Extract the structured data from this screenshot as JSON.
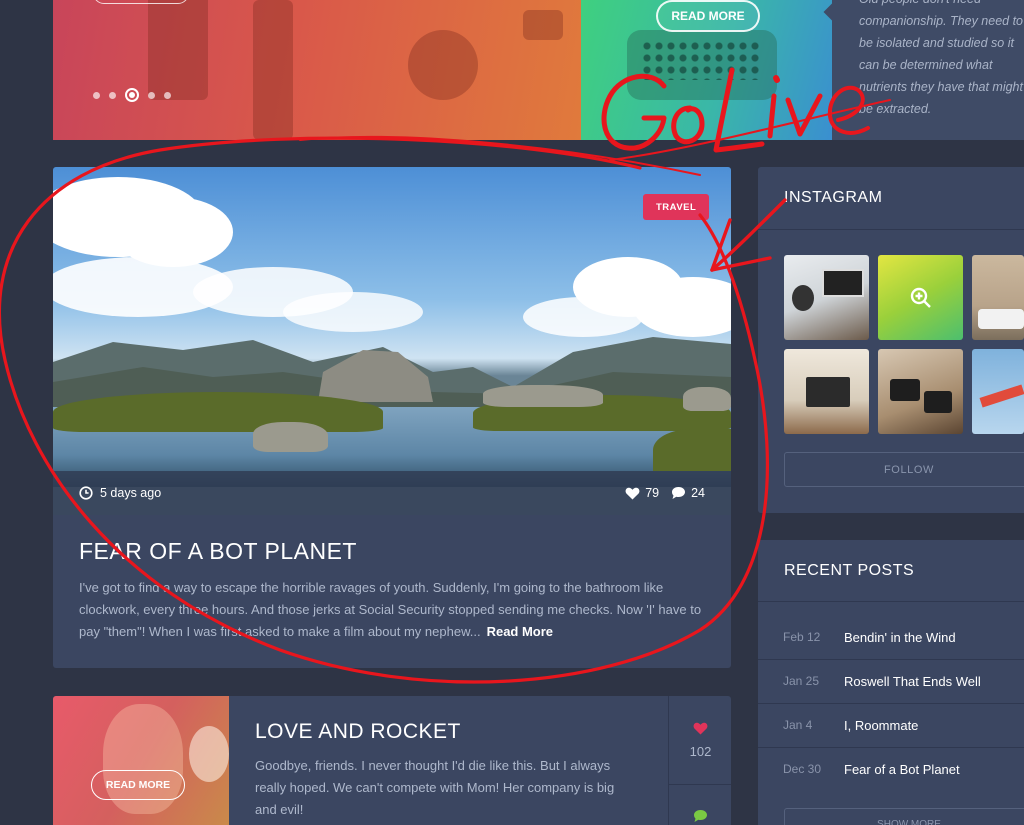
{
  "slider": {
    "dots": 5,
    "active_dot": 3
  },
  "feature_right": {
    "read_more": "READ MORE",
    "excerpt": "Old people don't need companionship. They need to be isolated and studied so it can be determined what nutrients they have that might be extracted."
  },
  "featured_post": {
    "tag": "TRAVEL",
    "time_ago": "5 days ago",
    "likes": "79",
    "comments": "24",
    "title": "FEAR OF A BOT PLANET",
    "excerpt": "I've got to find a way to escape the horrible ravages of youth. Suddenly, I'm going to the bathroom like clockwork, every three hours. And those jerks at Social Security stopped sending me checks. Now 'I' have to pay \"them\"! When I was first asked to make a film about my nephew...",
    "read_more": "Read More"
  },
  "instagram": {
    "title": "INSTAGRAM",
    "follow": "FOLLOW"
  },
  "recent_posts": {
    "title": "RECENT POSTS",
    "items": [
      {
        "date": "Feb 12",
        "title": "Bendin' in the Wind"
      },
      {
        "date": "Jan 25",
        "title": "Roswell That Ends Well"
      },
      {
        "date": "Jan 4",
        "title": "I, Roommate"
      },
      {
        "date": "Dec 30",
        "title": "Fear of a Bot Planet"
      }
    ],
    "show_more": "SHOW MORE"
  },
  "second_post": {
    "read_more": "READ MORE",
    "title": "LOVE AND ROCKET",
    "excerpt": "Goodbye, friends. I never thought I'd die like this. But I always really hoped. We can't compete with Mom! Her company is big and evil!",
    "likes": "102"
  },
  "annotation": {
    "text": "Go Live",
    "color": "#e8161d"
  },
  "colors": {
    "background": "#2e3445",
    "panel": "#3b4661",
    "accent": "#e0345a",
    "annotation_red": "#e8161d"
  }
}
